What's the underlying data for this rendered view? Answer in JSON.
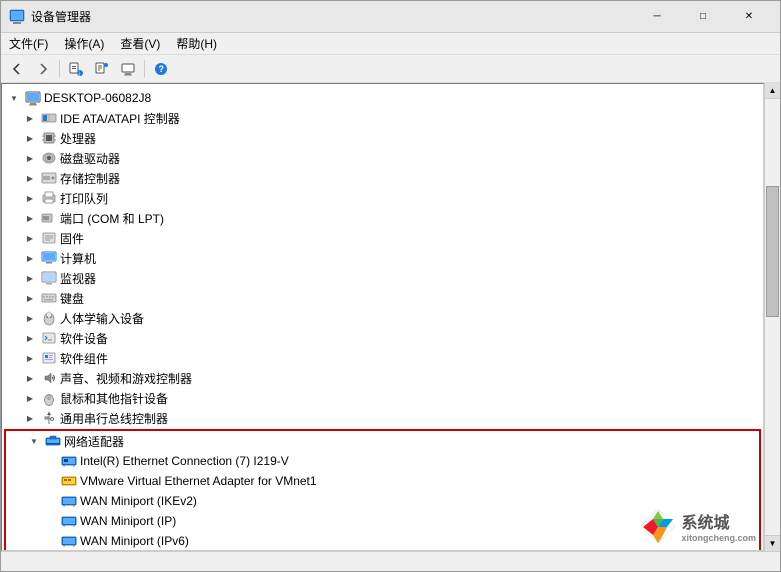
{
  "window": {
    "title": "设备管理器",
    "titleIcon": "device-manager-icon"
  },
  "menuBar": {
    "items": [
      {
        "id": "file",
        "label": "文件(F)"
      },
      {
        "id": "action",
        "label": "操作(A)"
      },
      {
        "id": "view",
        "label": "查看(V)"
      },
      {
        "id": "help",
        "label": "帮助(H)"
      }
    ]
  },
  "toolbar": {
    "buttons": [
      {
        "id": "back",
        "icon": "←",
        "title": "后退"
      },
      {
        "id": "forward",
        "icon": "→",
        "title": "前进"
      },
      {
        "id": "btn3",
        "icon": "☰",
        "title": "操作"
      },
      {
        "id": "btn4",
        "icon": "✦",
        "title": "属性"
      },
      {
        "id": "btn5",
        "icon": "⊞",
        "title": "显示"
      },
      {
        "id": "btn6",
        "icon": "🖥",
        "title": "计算机"
      }
    ]
  },
  "tree": {
    "rootNode": {
      "label": "DESKTOP-06082J8",
      "expanded": true
    },
    "items": [
      {
        "id": "ide",
        "label": "IDE ATA/ATAPI 控制器",
        "indent": 1,
        "expanded": false,
        "icon": "ide"
      },
      {
        "id": "cpu",
        "label": "处理器",
        "indent": 1,
        "expanded": false,
        "icon": "cpu"
      },
      {
        "id": "disk",
        "label": "磁盘驱动器",
        "indent": 1,
        "expanded": false,
        "icon": "disk"
      },
      {
        "id": "storage",
        "label": "存储控制器",
        "indent": 1,
        "expanded": false,
        "icon": "storage"
      },
      {
        "id": "print",
        "label": "打印队列",
        "indent": 1,
        "expanded": false,
        "icon": "print"
      },
      {
        "id": "com",
        "label": "端口 (COM 和 LPT)",
        "indent": 1,
        "expanded": false,
        "icon": "com"
      },
      {
        "id": "firmware",
        "label": "固件",
        "indent": 1,
        "expanded": false,
        "icon": "firmware"
      },
      {
        "id": "computer",
        "label": "计算机",
        "indent": 1,
        "expanded": false,
        "icon": "computer"
      },
      {
        "id": "monitor",
        "label": "监视器",
        "indent": 1,
        "expanded": false,
        "icon": "monitor"
      },
      {
        "id": "keyboard",
        "label": "键盘",
        "indent": 1,
        "expanded": false,
        "icon": "keyboard"
      },
      {
        "id": "hid",
        "label": "人体学输入设备",
        "indent": 1,
        "expanded": false,
        "icon": "hid"
      },
      {
        "id": "soft-dev",
        "label": "软件设备",
        "indent": 1,
        "expanded": false,
        "icon": "soft-dev"
      },
      {
        "id": "soft-comp",
        "label": "软件组件",
        "indent": 1,
        "expanded": false,
        "icon": "soft-comp"
      },
      {
        "id": "sound",
        "label": "声音、视频和游戏控制器",
        "indent": 1,
        "expanded": false,
        "icon": "sound"
      },
      {
        "id": "mouse",
        "label": "鼠标和其他指针设备",
        "indent": 1,
        "expanded": false,
        "icon": "mouse"
      },
      {
        "id": "usb",
        "label": "通用串行总线控制器",
        "indent": 1,
        "expanded": false,
        "icon": "usb"
      },
      {
        "id": "network",
        "label": "网络适配器",
        "indent": 1,
        "expanded": true,
        "icon": "network",
        "highlighted": true
      },
      {
        "id": "intel-eth",
        "label": "Intel(R) Ethernet Connection (7) I219-V",
        "indent": 2,
        "icon": "net-card",
        "highlighted": true
      },
      {
        "id": "vmware-eth",
        "label": "VMware Virtual Ethernet Adapter for VMnet1",
        "indent": 2,
        "icon": "net-card-vmware",
        "highlighted": true
      },
      {
        "id": "wan-ikev2",
        "label": "WAN Miniport (IKEv2)",
        "indent": 2,
        "icon": "net-wan",
        "highlighted": true
      },
      {
        "id": "wan-ip",
        "label": "WAN Miniport (IP)",
        "indent": 2,
        "icon": "net-wan",
        "highlighted": true
      },
      {
        "id": "wan-ipv6",
        "label": "WAN Miniport (IPv6)",
        "indent": 2,
        "icon": "net-wan",
        "highlighted": true
      }
    ]
  },
  "watermark": {
    "text": "系统城",
    "url": "xitongcheng.com"
  }
}
